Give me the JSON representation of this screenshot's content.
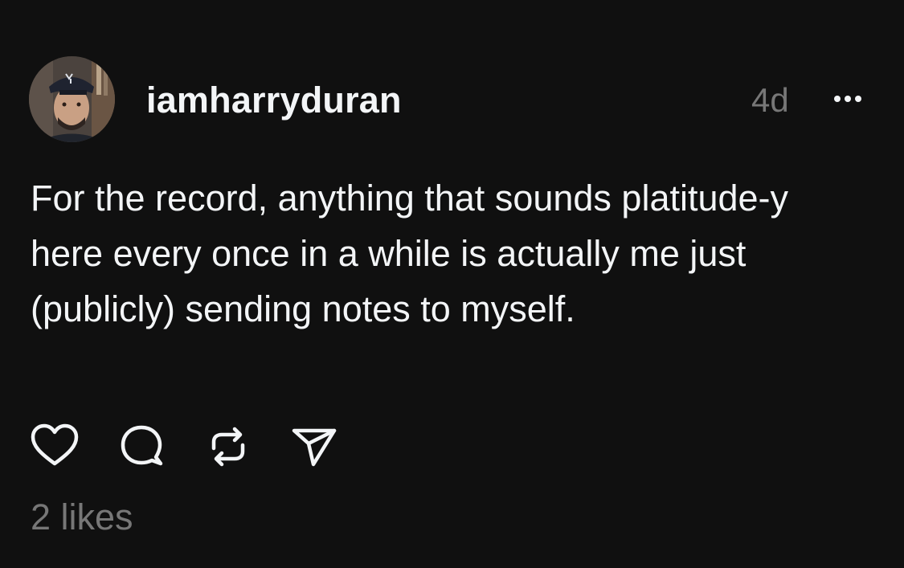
{
  "post": {
    "username": "iamharryduran",
    "timestamp": "4d",
    "text": "For the record, anything that sounds platitude-y here every once in a while is actually me just (publicly) sending notes to myself.",
    "likes": "2 likes",
    "avatar": "user-avatar-photo"
  },
  "actions": {
    "like": "heart-icon",
    "comment": "comment-bubble-icon",
    "repost": "repost-icon",
    "share": "send-icon",
    "more": "more-options-icon"
  },
  "colors": {
    "background": "#101010",
    "text": "#f3f5f7",
    "muted": "#777777"
  }
}
